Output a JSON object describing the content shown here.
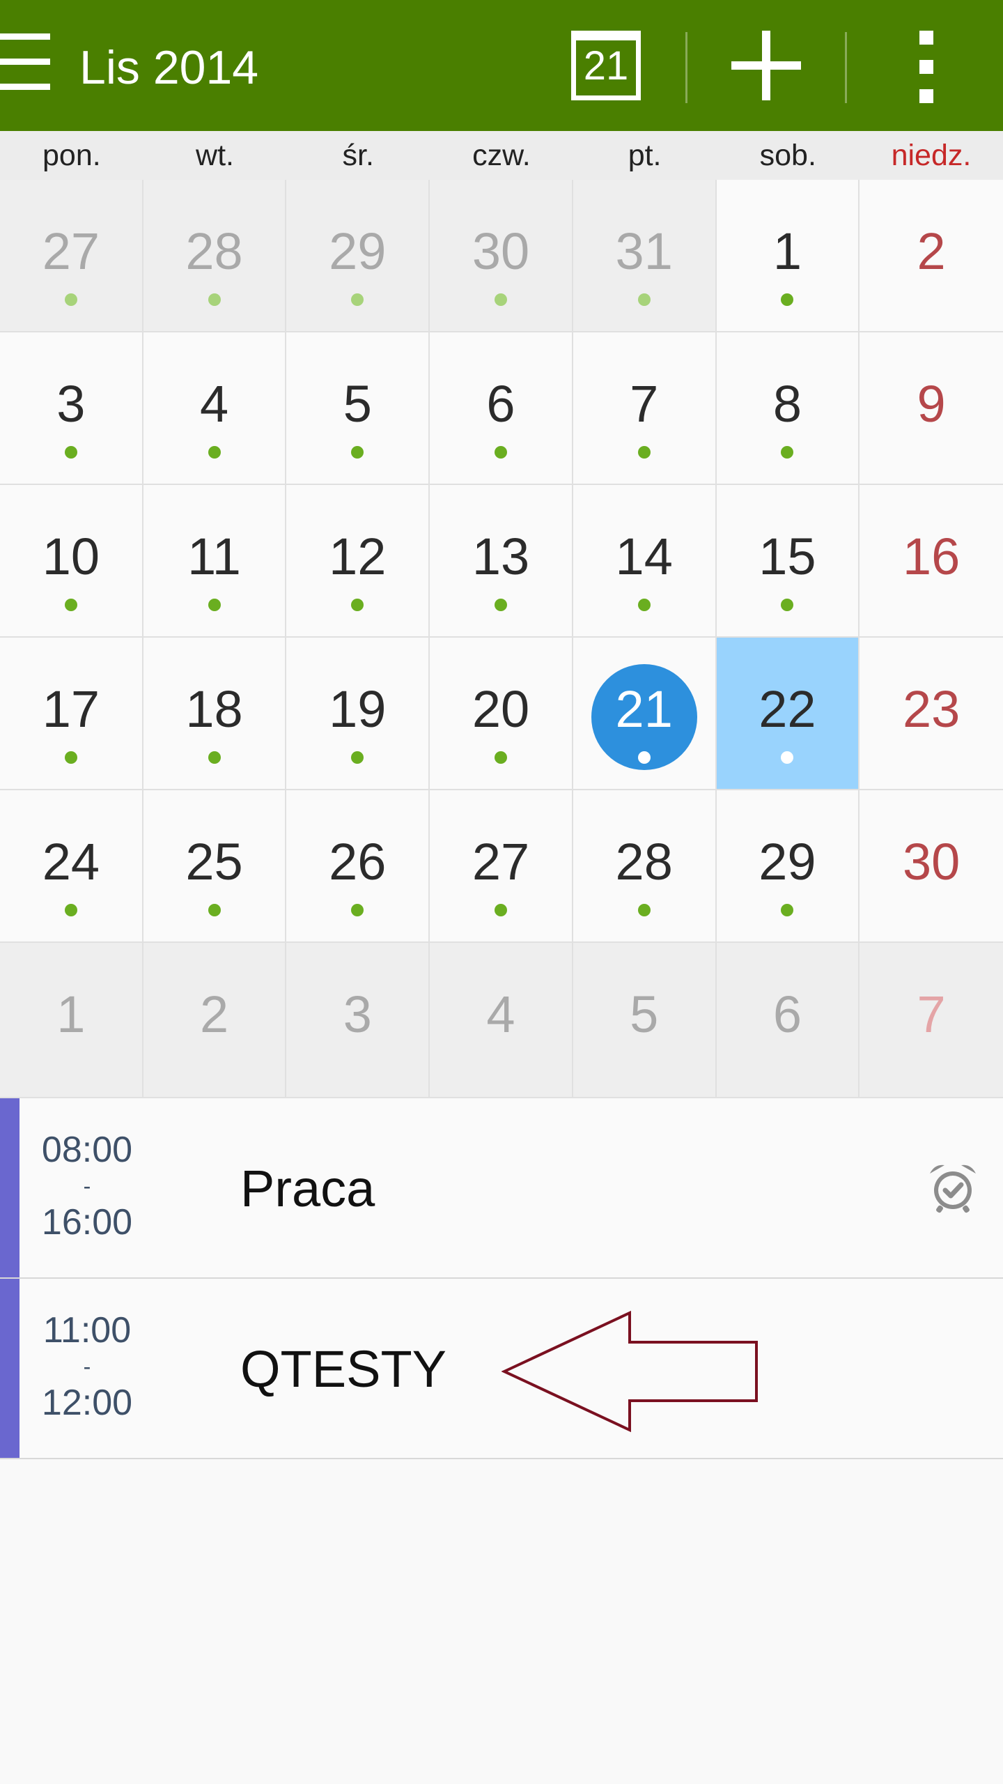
{
  "header": {
    "title": "Lis 2014",
    "today_day": "21",
    "background": "#4a7f00"
  },
  "weekdays": [
    "pon.",
    "wt.",
    "śr.",
    "czw.",
    "pt.",
    "sob.",
    "niedz."
  ],
  "weeks": [
    [
      "27",
      "28",
      "29",
      "30",
      "31",
      "1",
      "2"
    ],
    [
      "3",
      "4",
      "5",
      "6",
      "7",
      "8",
      "9"
    ],
    [
      "10",
      "11",
      "12",
      "13",
      "14",
      "15",
      "16"
    ],
    [
      "17",
      "18",
      "19",
      "20",
      "21",
      "22",
      "23"
    ],
    [
      "24",
      "25",
      "26",
      "27",
      "28",
      "29",
      "30"
    ],
    [
      "1",
      "2",
      "3",
      "4",
      "5",
      "6",
      "7"
    ]
  ],
  "events": [
    {
      "start": "08:00",
      "separator": "-",
      "end": "16:00",
      "title": "Praca",
      "has_alarm": true
    },
    {
      "start": "11:00",
      "separator": "-",
      "end": "12:00",
      "title": "QTESTY",
      "has_alarm": false
    }
  ],
  "colors": {
    "today_circle": "#2d90dd",
    "selected_day": "#99d3fd",
    "event_dot": "#6aae20",
    "sunday_text": "#b5474a",
    "event_bar": "#6a67cf",
    "annotation_arrow": "#7a1020"
  },
  "icons": {
    "menu": "hamburger-icon",
    "today": "calendar-today-icon",
    "add": "plus-icon",
    "more": "overflow-menu-icon",
    "alarm": "alarm-clock-icon",
    "annotation": "arrow-left-outline"
  }
}
